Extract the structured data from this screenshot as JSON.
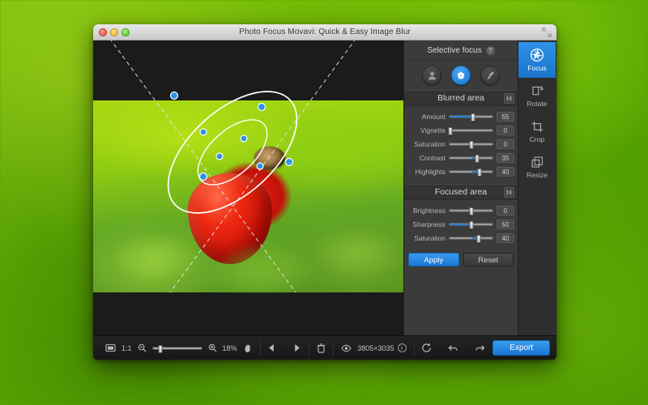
{
  "window": {
    "title": "Photo Focus Movavi: Quick & Easy Image Blur",
    "traffic_lights": [
      "close",
      "minimize",
      "zoom"
    ],
    "fullscreen_icon": "fullscreen-arrows-icon"
  },
  "panel": {
    "header": "Selective focus",
    "help_icon": "?",
    "modes": [
      {
        "name": "portrait-mode",
        "icon": "person-icon",
        "active": false
      },
      {
        "name": "flower-mode",
        "icon": "flower-icon",
        "active": true
      },
      {
        "name": "brush-mode",
        "icon": "brush-icon",
        "active": false
      }
    ],
    "sections": [
      {
        "title": "Blurred area",
        "reset_icon": "reset-icon",
        "sliders": [
          {
            "label": "Amount",
            "value": "55",
            "fill_pct": 55,
            "knob_pct": 55,
            "bipolar": false
          },
          {
            "label": "Vignette",
            "value": "0",
            "fill_pct": 0,
            "knob_pct": 2,
            "bipolar": false
          },
          {
            "label": "Saturation",
            "value": "0",
            "fill_pct": 0,
            "knob_pct": 50,
            "bipolar": true
          },
          {
            "label": "Contrast",
            "value": "35",
            "fill_pct": 50,
            "knob_pct": 65,
            "bipolar": true
          },
          {
            "label": "Highlights",
            "value": "40",
            "fill_pct": 50,
            "knob_pct": 70,
            "bipolar": true
          }
        ]
      },
      {
        "title": "Focused area",
        "reset_icon": "reset-icon",
        "sliders": [
          {
            "label": "Brightness",
            "value": "0",
            "fill_pct": 0,
            "knob_pct": 50,
            "bipolar": true
          },
          {
            "label": "Sharpness",
            "value": "50",
            "fill_pct": 50,
            "knob_pct": 50,
            "bipolar": false
          },
          {
            "label": "Saturation",
            "value": "40",
            "fill_pct": 50,
            "knob_pct": 68,
            "bipolar": true
          }
        ]
      }
    ],
    "apply_label": "Apply",
    "reset_label": "Reset"
  },
  "tabs": [
    {
      "label": "Focus",
      "icon": "aperture-icon",
      "active": true
    },
    {
      "label": "Rotate",
      "icon": "rotate-icon",
      "active": false
    },
    {
      "label": "Crop",
      "icon": "crop-icon",
      "active": false
    },
    {
      "label": "Resize",
      "icon": "resize-icon",
      "active": false
    }
  ],
  "toolbar": {
    "fit_icon": "fit-to-screen-icon",
    "one_to_one_label": "1:1",
    "zoom_out_icon": "zoom-out-icon",
    "zoom_in_icon": "zoom-in-icon",
    "zoom_level": "18%",
    "hand_icon": "hand-tool-icon",
    "prev_icon": "previous-icon",
    "next_icon": "next-icon",
    "delete_icon": "trash-icon",
    "preview_icon": "eye-icon",
    "dimensions": "3805×3035",
    "info_icon": "info-icon",
    "refresh_icon": "refresh-icon",
    "undo_icon": "undo-icon",
    "redo_icon": "redo-icon",
    "export_label": "Export"
  },
  "canvas": {
    "image_subject": "strawberry-with-snail-photo",
    "focus_tool": "elliptical-focus-overlay",
    "handles": 9
  },
  "colors": {
    "accent": "#1876d4",
    "panel_bg": "#3b3b3b",
    "window_bg": "#2b2b2b",
    "toolbar_bg": "#1d1d1d",
    "desktop": "#6fb806"
  }
}
